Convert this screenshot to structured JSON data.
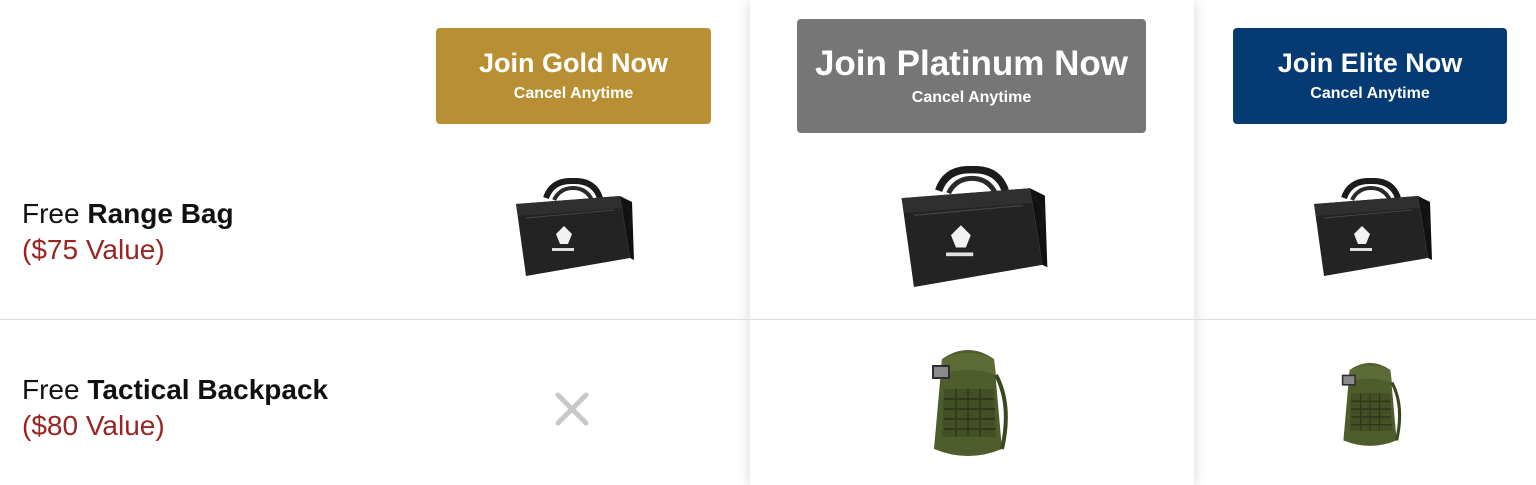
{
  "colors": {
    "gold": "#b88f33",
    "platinum": "#767676",
    "elite": "#053a73",
    "value_text": "#9a2421",
    "x_mark": "#c8c8c8"
  },
  "plans": {
    "gold": {
      "cta": "Join Gold Now",
      "sub": "Cancel Anytime"
    },
    "platinum": {
      "cta": "Join Platinum Now",
      "sub": "Cancel Anytime"
    },
    "elite": {
      "cta": "Join Elite Now",
      "sub": "Cancel Anytime"
    }
  },
  "rows": [
    {
      "prefix": "Free",
      "name": "Range Bag",
      "value": "($75 Value)",
      "gold": "range-bag-image",
      "platinum": "range-bag-image",
      "elite": "range-bag-image"
    },
    {
      "prefix": "Free",
      "name": "Tactical Backpack",
      "value": "($80 Value)",
      "gold": "x-icon",
      "platinum": "tactical-backpack-image",
      "elite": "tactical-backpack-image"
    }
  ]
}
